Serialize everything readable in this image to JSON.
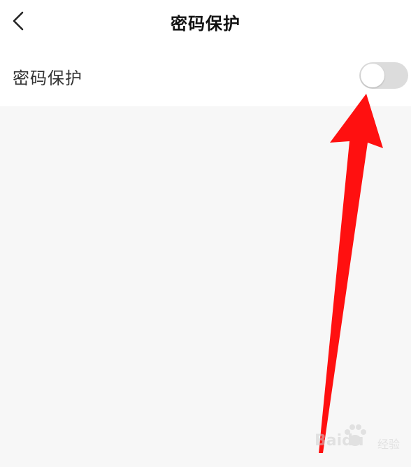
{
  "header": {
    "title": "密码保护",
    "back_icon": "chevron-left-icon"
  },
  "setting": {
    "label": "密码保护",
    "toggle_on": false
  },
  "colors": {
    "toggle_off_track": "#dcdcdc",
    "annotation_arrow": "#ff0000",
    "content_background": "#f7f7f7"
  },
  "watermark": {
    "brand": "Baidu",
    "sub": "经验"
  }
}
